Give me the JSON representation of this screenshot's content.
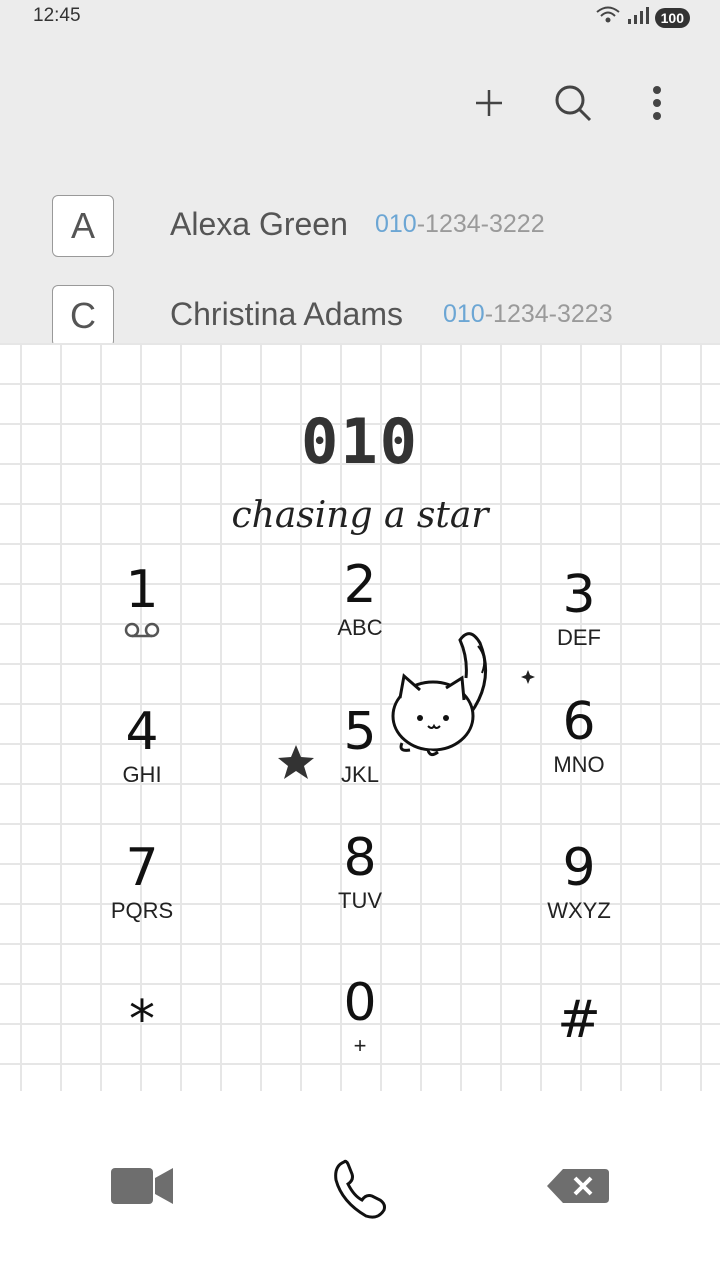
{
  "status_bar": {
    "time": "12:45",
    "battery": "100"
  },
  "toolbar": {
    "add_icon": "plus-icon",
    "search_icon": "search-icon",
    "more_icon": "more-vert-icon"
  },
  "contacts": [
    {
      "letter": "A",
      "name": "Alexa Green",
      "number_prefix": "010",
      "number_rest": "-1234-3222"
    },
    {
      "letter": "C",
      "name": "Christina Adams",
      "number_prefix": "010",
      "number_rest": "-1234-3223"
    }
  ],
  "dialer": {
    "entered_number": "010",
    "tagline": "chasing a star",
    "keys": [
      {
        "digit": "1",
        "letters": ""
      },
      {
        "digit": "2",
        "letters": "ABC"
      },
      {
        "digit": "3",
        "letters": "DEF"
      },
      {
        "digit": "4",
        "letters": "GHI"
      },
      {
        "digit": "5",
        "letters": "JKL"
      },
      {
        "digit": "6",
        "letters": "MNO"
      },
      {
        "digit": "7",
        "letters": "PQRS"
      },
      {
        "digit": "8",
        "letters": "TUV"
      },
      {
        "digit": "9",
        "letters": "WXYZ"
      },
      {
        "digit": "*",
        "letters": ""
      },
      {
        "digit": "0",
        "letters": "+"
      },
      {
        "digit": "#",
        "letters": ""
      }
    ]
  },
  "bottom_bar": {
    "video_icon": "video-call-icon",
    "call_icon": "phone-call-icon",
    "delete_icon": "backspace-icon"
  },
  "colors": {
    "number_highlight": "#6ca6d4",
    "top_background": "#ececec"
  }
}
